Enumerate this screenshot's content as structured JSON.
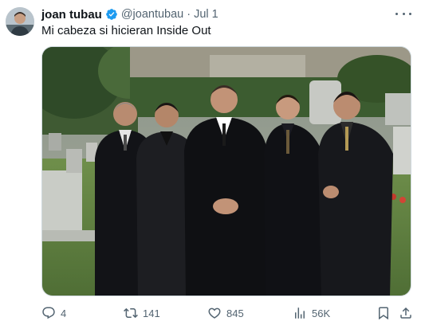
{
  "tweet": {
    "author": {
      "display_name": "joan tubau",
      "handle": "@joantubau",
      "verified_icon": "verified-badge-icon",
      "avatar_icon": "user-avatar"
    },
    "separator": "·",
    "date": "Jul 1",
    "text": "Mi cabeza si hicieran Inside Out",
    "media": {
      "icon": "photo-five-men-in-black-suits-cemetery"
    },
    "actions": {
      "reply": {
        "icon": "reply-icon",
        "count": "4"
      },
      "retweet": {
        "icon": "retweet-icon",
        "count": "141"
      },
      "like": {
        "icon": "heart-icon",
        "count": "845"
      },
      "views": {
        "icon": "analytics-icon",
        "count": "56K"
      },
      "bookmark": {
        "icon": "bookmark-icon"
      },
      "share": {
        "icon": "share-icon"
      }
    },
    "more_icon": "more-options-icon"
  },
  "colors": {
    "text_primary": "#0f1419",
    "text_secondary": "#536471",
    "verified_blue": "#1d9bf0",
    "border": "#cfd9de"
  }
}
